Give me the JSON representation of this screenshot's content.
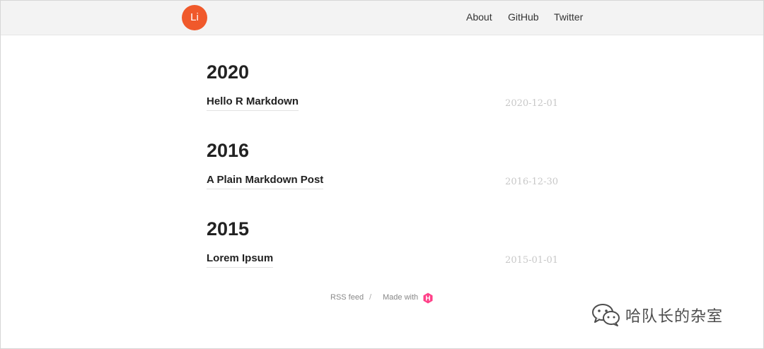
{
  "header": {
    "logo_text": "Li",
    "nav": {
      "about": "About",
      "github": "GitHub",
      "twitter": "Twitter"
    }
  },
  "archive": [
    {
      "year": "2020",
      "posts": [
        {
          "title": "Hello R Markdown",
          "date": "2020-12-01"
        }
      ]
    },
    {
      "year": "2016",
      "posts": [
        {
          "title": "A Plain Markdown Post",
          "date": "2016-12-30"
        }
      ]
    },
    {
      "year": "2015",
      "posts": [
        {
          "title": "Lorem Ipsum",
          "date": "2015-01-01"
        }
      ]
    }
  ],
  "footer": {
    "rss": "RSS feed",
    "separator": "/",
    "made_with": "Made with",
    "hugo_icon": "hugo-logo-icon",
    "hugo_letter": "H"
  },
  "watermark": {
    "text": "哈队长的杂室",
    "icon": "wechat-icon"
  },
  "colors": {
    "accent": "#f0592b",
    "hugo": "#ff4088",
    "date": "#c8c8c8"
  }
}
